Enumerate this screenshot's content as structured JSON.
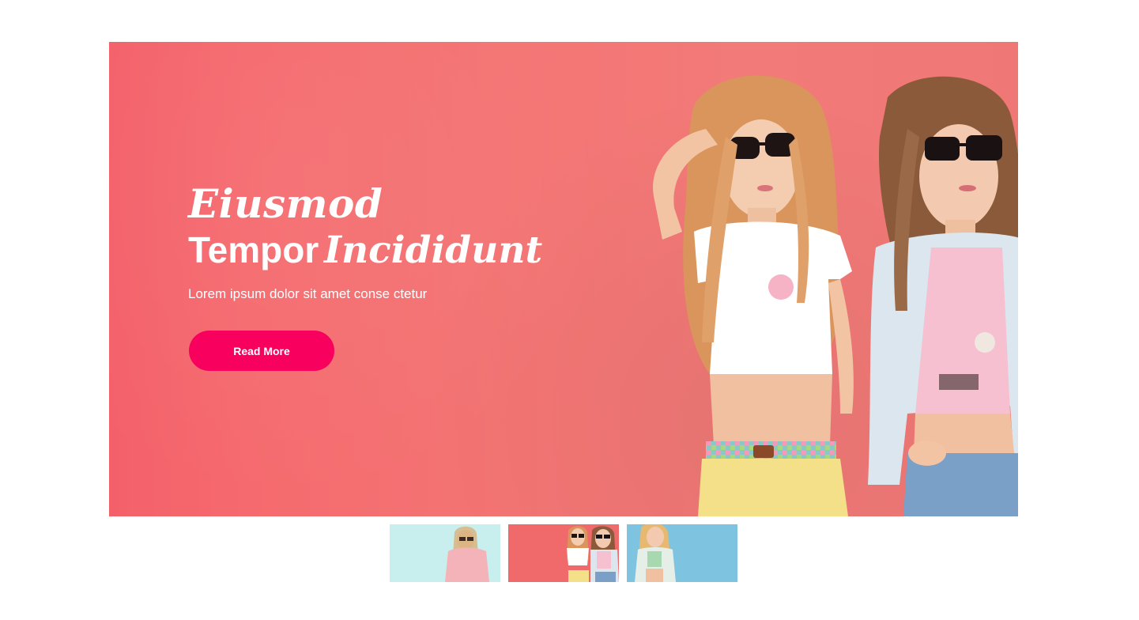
{
  "slide": {
    "title_line1": "Eiusmod",
    "title_bold": "Tempor",
    "title_italic": "Incididunt",
    "subtitle": "Lorem ipsum dolor sit amet conse ctetur",
    "button_label": "Read More"
  },
  "colors": {
    "slide_background": "#f4606a",
    "button": "#f7005e",
    "thumb1_background": "#c8eeee",
    "thumb2_background": "#f06a6c",
    "thumb3_background": "#7ec4e0"
  },
  "thumbnails": {
    "count": 3,
    "active_index": 1
  }
}
